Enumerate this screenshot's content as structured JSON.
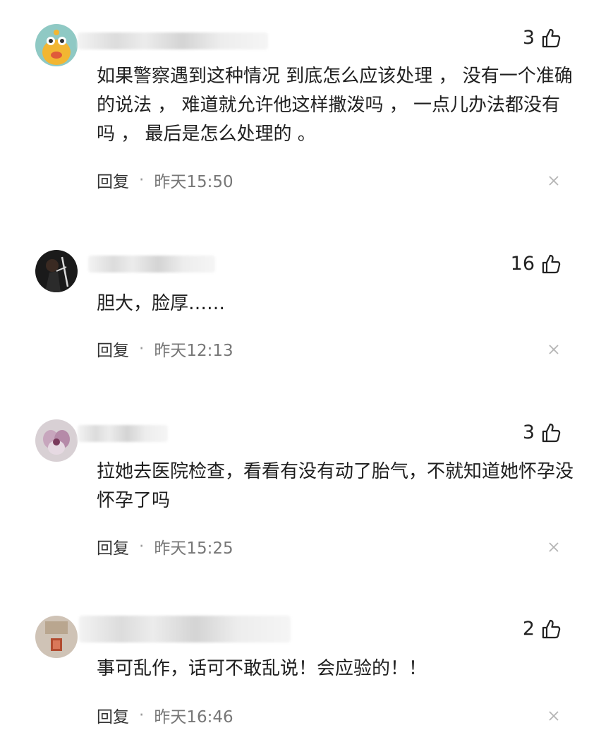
{
  "comments": [
    {
      "likes": "3",
      "text": "如果警察遇到这种情况 到底怎么应该处理 ， 没有一个准确的说法 ， 难道就允许他这样撒泼吗 ， 一点儿办法都没有吗 ， 最后是怎么处理的 。",
      "reply_label": "回复",
      "separator": "·",
      "time": "昨天15:50"
    },
    {
      "likes": "16",
      "text": "胆大，脸厚……",
      "reply_label": "回复",
      "separator": "·",
      "time": "昨天12:13"
    },
    {
      "likes": "3",
      "text": "拉她去医院检查，看看有没有动了胎气，不就知道她怀孕没怀孕了吗",
      "reply_label": "回复",
      "separator": "·",
      "time": "昨天15:25"
    },
    {
      "likes": "2",
      "text": "事可乱作，话可不敢乱说！会应验的！！",
      "reply_label": "回复",
      "separator": "·",
      "time": "昨天16:46"
    }
  ],
  "icons": {
    "like": "thumbs-up-icon",
    "close": "close-icon"
  }
}
